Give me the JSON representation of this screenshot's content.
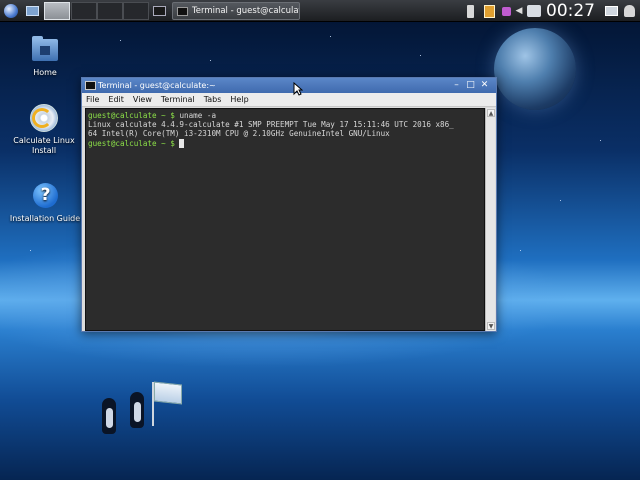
{
  "panel": {
    "clock": "00:27",
    "taskbar_window_title": "Terminal - guest@calculate:~"
  },
  "desktop": {
    "icons": [
      {
        "label": "Home"
      },
      {
        "label": "Calculate Linux Install"
      },
      {
        "label": "Installation Guide"
      }
    ]
  },
  "terminal": {
    "title": "Terminal - guest@calculate:~",
    "window_controls": {
      "minimize": "–",
      "maximize": "□",
      "close": "✕"
    },
    "menu": [
      "File",
      "Edit",
      "View",
      "Terminal",
      "Tabs",
      "Help"
    ],
    "lines": [
      {
        "prompt": "guest@calculate ~ $",
        "command": " uname -a"
      },
      {
        "output": "Linux calculate 4.4.9-calculate #1 SMP PREEMPT Tue May 17 15:11:46 UTC 2016 x86_"
      },
      {
        "output": "64 Intel(R) Core(TM) i3-2310M CPU @ 2.10GHz GenuineIntel GNU/Linux"
      },
      {
        "prompt": "guest@calculate ~ $",
        "command": " "
      }
    ],
    "scroll_up": "▲",
    "scroll_down": "▼"
  },
  "colors": {
    "prompt": "#8ce048",
    "terminal_bg": "#2c2c2c",
    "titlebar": "#4a78bd"
  },
  "icons": {
    "menu": "start-menu-icon",
    "show_desktop": "show-desktop-icon",
    "battery": "battery-icon",
    "clipboard": "clipboard-icon",
    "network": "network-icon",
    "volume": "volume-icon",
    "keyboard": "keyboard-layout-icon",
    "display": "display-icon",
    "user": "user-icon"
  }
}
